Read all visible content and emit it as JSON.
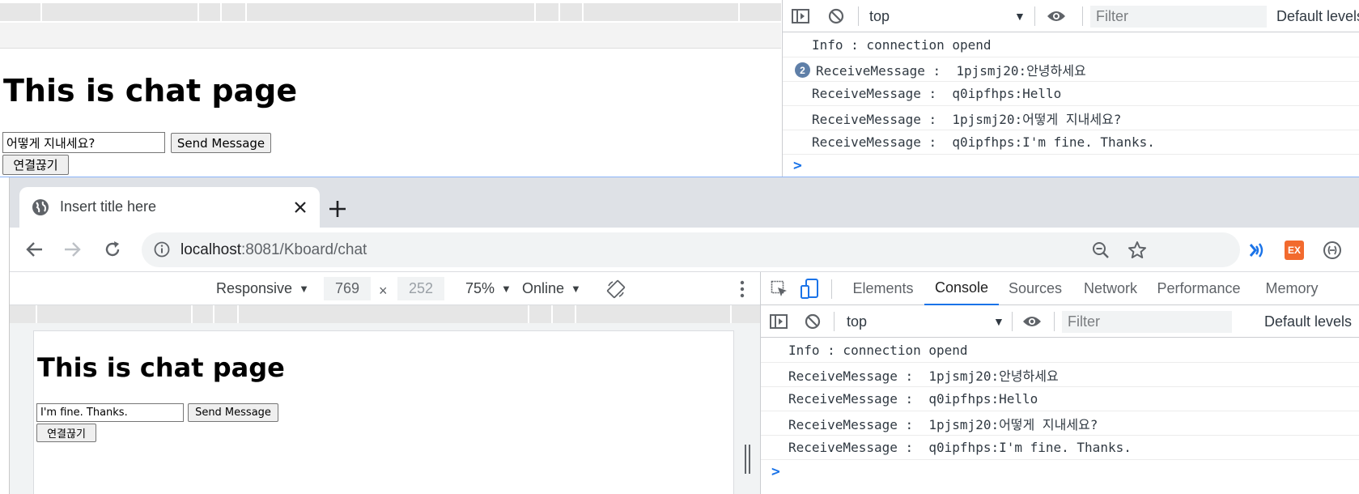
{
  "background_window": {
    "page": {
      "heading": "This is chat page",
      "message_input_value": "어떻게 지내세요?",
      "send_button_label": "Send Message",
      "disconnect_button_label": "연결끊기"
    },
    "console": {
      "context": "top",
      "filter_placeholder": "Filter",
      "levels_label": "Default levels",
      "messages": [
        {
          "text": "Info : connection opend",
          "count": ""
        },
        {
          "text": "ReceiveMessage :  1pjsmj20:안녕하세요",
          "count": "2"
        },
        {
          "text": "ReceiveMessage :  q0ipfhps:Hello",
          "count": ""
        },
        {
          "text": "ReceiveMessage :  1pjsmj20:어떻게 지내세요?",
          "count": ""
        },
        {
          "text": "ReceiveMessage :  q0ipfhps:I'm fine. Thanks.",
          "count": ""
        }
      ],
      "prompt": ">"
    }
  },
  "browser": {
    "tab_title": "Insert title here",
    "url_host": "localhost",
    "url_rest": ":8081/Kboard/chat",
    "extension_badge": "EX",
    "device_toolbar": {
      "device": "Responsive",
      "width": "769",
      "times": "×",
      "height": "252",
      "zoom": "75%",
      "network": "Online"
    },
    "page": {
      "heading": "This is chat page",
      "message_input_value": "I'm fine. Thanks.",
      "send_button_label": "Send Message",
      "disconnect_button_label": "연결끊기"
    },
    "devtools": {
      "tabs": [
        "Elements",
        "Console",
        "Sources",
        "Network",
        "Performance",
        "Memory"
      ],
      "active_tab": "Console",
      "context": "top",
      "filter_placeholder": "Filter",
      "levels_label": "Default levels",
      "messages": [
        "Info : connection opend",
        "ReceiveMessage :  1pjsmj20:안녕하세요",
        "ReceiveMessage :  q0ipfhps:Hello",
        "ReceiveMessage :  1pjsmj20:어떻게 지내세요?",
        "ReceiveMessage :  q0ipfhps:I'm fine. Thanks."
      ],
      "prompt": ">"
    }
  },
  "colors": {
    "accent": "#1a73e8",
    "badge": "#5f7fa8",
    "extension": "#f26a2e",
    "wallet": "#1a73e8"
  }
}
